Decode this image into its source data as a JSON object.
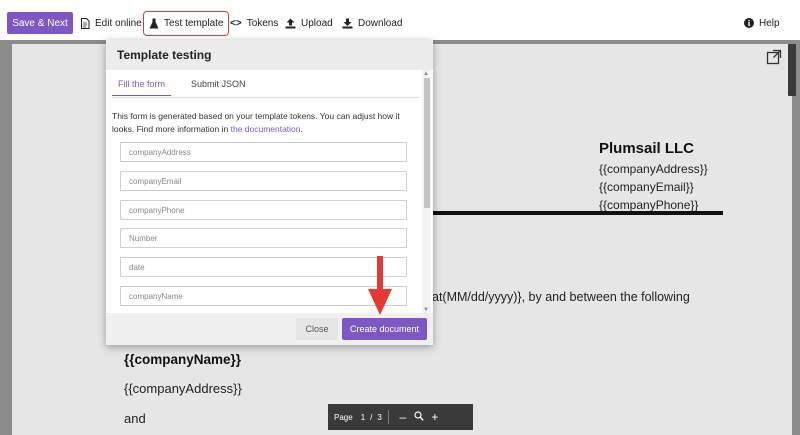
{
  "toolbar": {
    "save_next": "Save & Next",
    "edit_online": "Edit online",
    "test_template": "Test template",
    "tokens": "Tokens",
    "upload": "Upload",
    "download": "Download",
    "help": "Help"
  },
  "document": {
    "company_name": "Plumsail LLC",
    "tokens": [
      "{{companyAddress}}",
      "{{companyEmail}}",
      "{{companyPhone}}"
    ],
    "paragraph": "at(MM/dd/yyyy)}, by and between the following",
    "body_company_name": "{{companyName}}",
    "body_company_address": "{{companyAddress}}",
    "body_and": "and"
  },
  "pager": {
    "page_label": "Page",
    "current": "1",
    "separator": "/",
    "total": "3"
  },
  "modal": {
    "title": "Template testing",
    "tabs": [
      {
        "label": "Fill the form",
        "active": true
      },
      {
        "label": "Submit JSON",
        "active": false
      }
    ],
    "description_pre": "This form is generated based on your template tokens. You can adjust how it looks. Find more information in ",
    "description_link": "the documentation",
    "description_post": ".",
    "fields": [
      {
        "placeholder": "companyAddress"
      },
      {
        "placeholder": "companyEmail"
      },
      {
        "placeholder": "companyPhone"
      },
      {
        "placeholder": "Number"
      },
      {
        "placeholder": "date"
      },
      {
        "placeholder": "companyName"
      }
    ],
    "close_label": "Close",
    "create_label": "Create document"
  },
  "colors": {
    "accent": "#7e57c2",
    "highlight": "#e53935"
  }
}
